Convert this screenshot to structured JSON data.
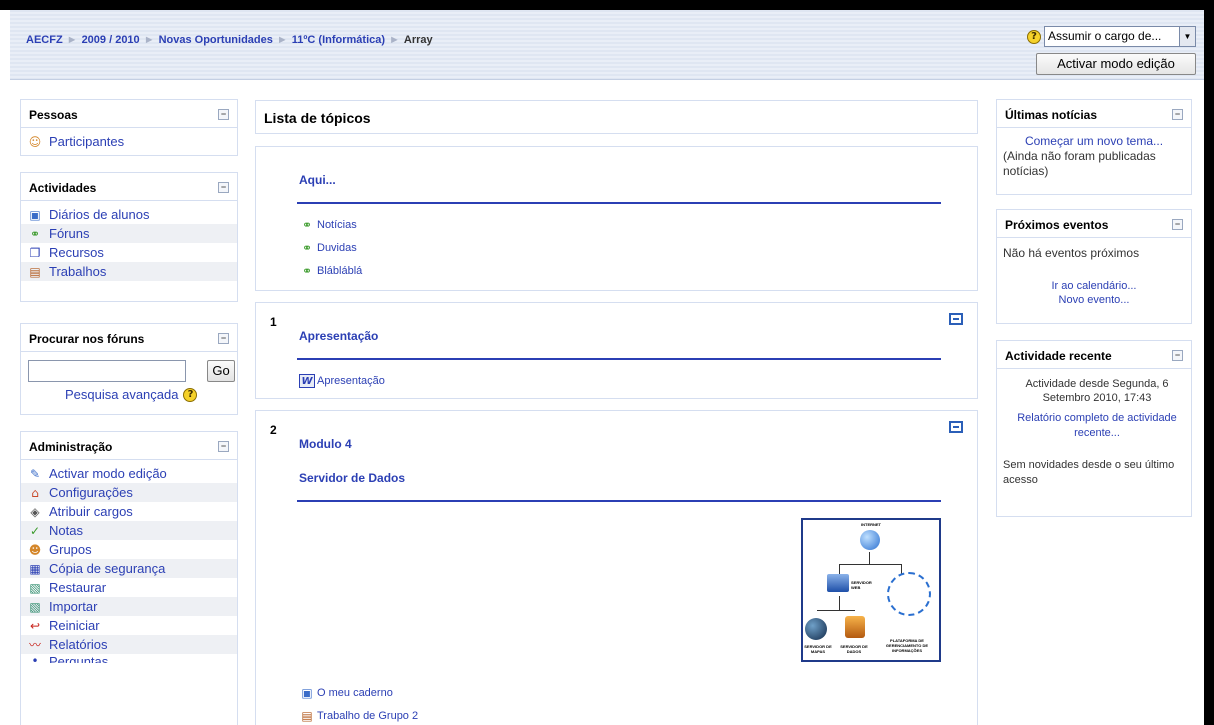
{
  "breadcrumb": {
    "items": [
      "AECFZ",
      "2009 / 2010",
      "Novas Oportunidades",
      "11ºC (Informática)"
    ],
    "current": "Array",
    "separator": "►"
  },
  "role_select": {
    "value": "Assumir o cargo de...",
    "help": "?"
  },
  "edit_button": "Activar modo edição",
  "pessoas": {
    "title": "Pessoas",
    "items": [
      "Participantes"
    ]
  },
  "actividades": {
    "title": "Actividades",
    "items": [
      "Diários de alunos",
      "Fóruns",
      "Recursos",
      "Trabalhos"
    ]
  },
  "search": {
    "title": "Procurar nos fóruns",
    "button": "Go",
    "advanced": "Pesquisa avançada",
    "help": "?"
  },
  "admin": {
    "title": "Administração",
    "items": [
      "Activar modo edição",
      "Configurações",
      "Atribuir cargos",
      "Notas",
      "Grupos",
      "Cópia de segurança",
      "Restaurar",
      "Importar",
      "Reiniciar",
      "Relatórios",
      "Perguntas"
    ]
  },
  "main": {
    "title": "Lista de tópicos",
    "section0": {
      "title": "Aqui...",
      "items": [
        "Notícias",
        "Duvidas",
        "Blábláblá"
      ]
    },
    "section1": {
      "number": "1",
      "title": "Apresentação",
      "items": [
        "Apresentação"
      ]
    },
    "section2": {
      "number": "2",
      "title": "Modulo 4",
      "subtitle": "Servidor de Dados",
      "items": [
        "O meu caderno",
        "Trabalho de Grupo 2"
      ],
      "diagram_labels": [
        "INTERNET",
        "SERVIDOR WEB",
        "SERVIDOR DE MAPAS",
        "SERVIDOR DE DADOS",
        "PLATAFORMA DE GERENCIAMENTO DE INFORMAÇÕES"
      ]
    }
  },
  "news": {
    "title": "Últimas notícias",
    "new_topic": "Começar um novo tema...",
    "none": "(Ainda não foram publicadas notícias)"
  },
  "events": {
    "title": "Próximos eventos",
    "none": "Não há eventos próximos",
    "calendar": "Ir ao calendário...",
    "new_event": "Novo evento..."
  },
  "recent": {
    "title": "Actividade recente",
    "since": "Actividade desde Segunda, 6 Setembro 2010, 17:43",
    "report": "Relatório completo de actividade recente...",
    "nothing": "Sem novidades desde o seu último acesso"
  },
  "icons": {
    "people": "people-icon",
    "journal": "journal-icon",
    "forum": "forum-icon",
    "resource": "resource-icon",
    "assignment": "assignment-icon",
    "word": "word-doc-icon"
  },
  "colors": {
    "link": "#2b3fb4",
    "border": "#d5def0",
    "rule": "#2b3fb4"
  }
}
